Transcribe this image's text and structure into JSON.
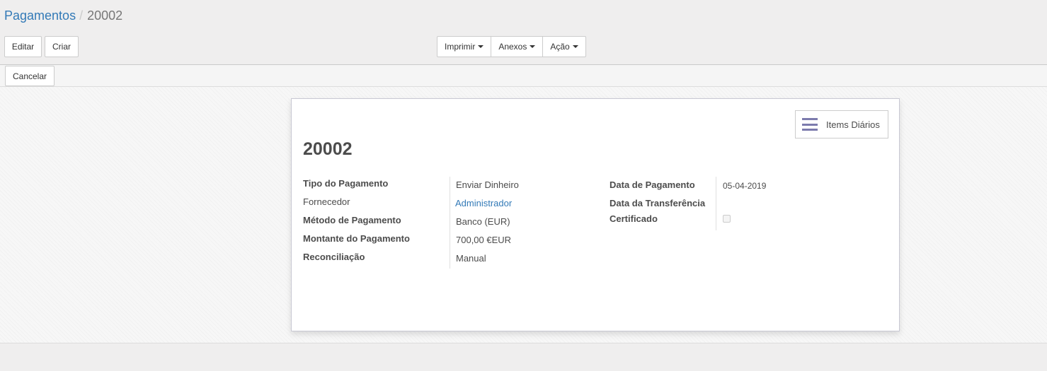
{
  "breadcrumb": {
    "parent": "Pagamentos",
    "separator": "/",
    "current": "20002"
  },
  "toolbar": {
    "edit_label": "Editar",
    "create_label": "Criar",
    "print_label": "Imprimir",
    "attachments_label": "Anexos",
    "action_label": "Ação"
  },
  "statusbar": {
    "cancel_label": "Cancelar"
  },
  "form": {
    "smart_button_label": "Items Diários",
    "smart_button_icon": "list-icon",
    "title": "20002",
    "left_fields": [
      {
        "label": "Tipo do Pagamento",
        "value": "Enviar Dinheiro"
      },
      {
        "label": "Fornecedor",
        "value": "Administrador"
      },
      {
        "label": "Método de Pagamento",
        "value": "Banco (EUR)"
      },
      {
        "label": "Montante do Pagamento",
        "value": "700,00 €EUR"
      },
      {
        "label": "Reconciliação",
        "value": "Manual"
      }
    ],
    "right_fields": [
      {
        "label": "Data de Pagamento",
        "value": "05-04-2019"
      },
      {
        "label": "Data da Transferência",
        "value": ""
      },
      {
        "label": "Certificado",
        "checked": false
      }
    ]
  },
  "colors": {
    "link": "#337ab7",
    "accent": "#7c7bad"
  }
}
